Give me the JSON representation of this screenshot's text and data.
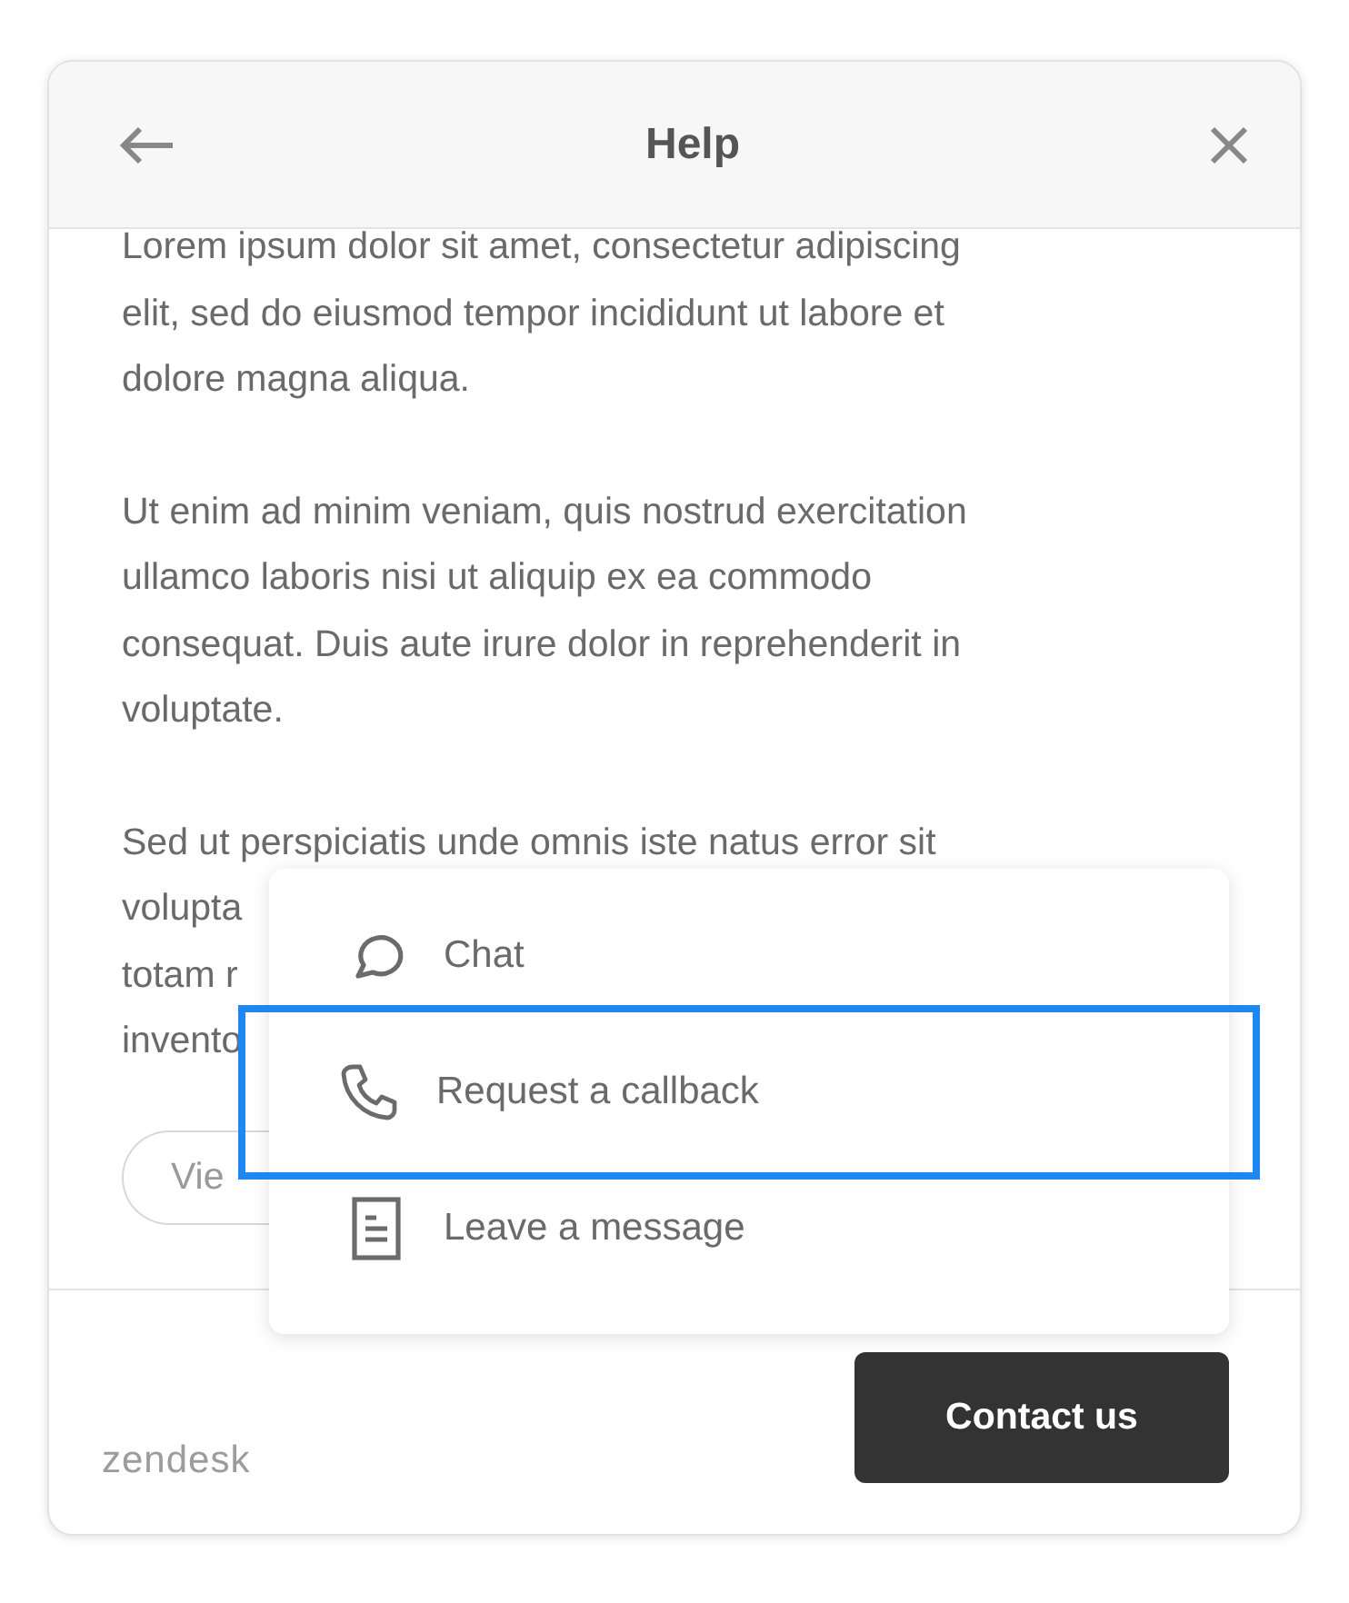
{
  "window": {
    "title": "Help"
  },
  "paragraphs": [
    {
      "lines": [
        "Lorem ipsum dolor sit amet, consectetur adipiscing",
        "elit, sed do eiusmod tempor incididunt ut labore et",
        "dolore magna aliqua."
      ]
    },
    {
      "lines": [
        "Ut enim ad minim veniam, quis nostrud exercitation",
        "ullamco laboris nisi ut aliquip ex ea commodo",
        "consequat. Duis aute irure dolor in reprehenderit in",
        "voluptate."
      ]
    },
    {
      "lines": [
        "Sed ut perspiciatis unde omnis iste natus error sit",
        "volupta",
        "totam r",
        "invento"
      ]
    }
  ],
  "view_button": {
    "label": "Vie"
  },
  "menu": [
    {
      "kind": "chat",
      "label": "Chat",
      "selected": false
    },
    {
      "kind": "phone",
      "label": "Request a callback",
      "selected": true
    },
    {
      "kind": "message",
      "label": "Leave a message",
      "selected": false
    }
  ],
  "footer": {
    "logo": "zendesk",
    "button": "Contact us"
  }
}
